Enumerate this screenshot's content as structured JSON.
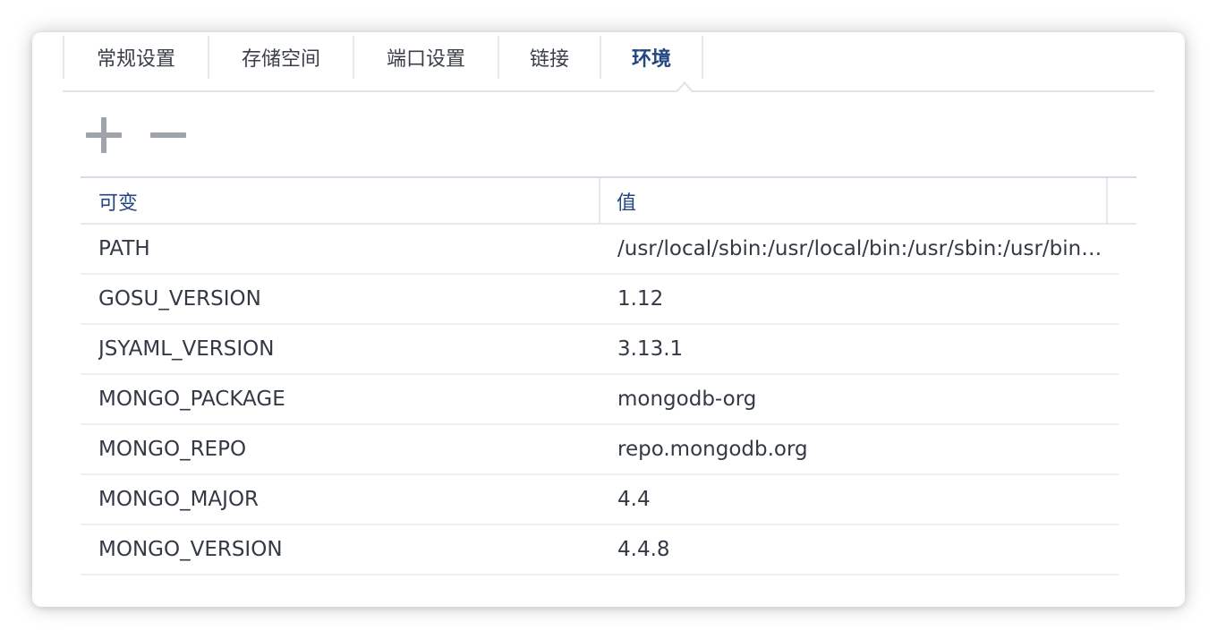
{
  "tabs": [
    {
      "label": "常规设置",
      "active": false
    },
    {
      "label": "存储空间",
      "active": false
    },
    {
      "label": "端口设置",
      "active": false
    },
    {
      "label": "链接",
      "active": false
    },
    {
      "label": "环境",
      "active": true
    }
  ],
  "toolbar": {
    "add_icon": "plus-icon",
    "remove_icon": "minus-icon"
  },
  "table": {
    "columns": [
      "可变",
      "值"
    ],
    "rows": [
      {
        "name": "PATH",
        "value": "/usr/local/sbin:/usr/local/bin:/usr/sbin:/usr/bin:/sbin:/bin"
      },
      {
        "name": "GOSU_VERSION",
        "value": "1.12"
      },
      {
        "name": "JSYAML_VERSION",
        "value": "3.13.1"
      },
      {
        "name": "MONGO_PACKAGE",
        "value": "mongodb-org"
      },
      {
        "name": "MONGO_REPO",
        "value": "repo.mongodb.org"
      },
      {
        "name": "MONGO_MAJOR",
        "value": "4.4"
      },
      {
        "name": "MONGO_VERSION",
        "value": "4.4.8"
      }
    ]
  },
  "colors": {
    "accent": "#22467f",
    "text": "#333a45",
    "icon": "#9fa4aa"
  }
}
